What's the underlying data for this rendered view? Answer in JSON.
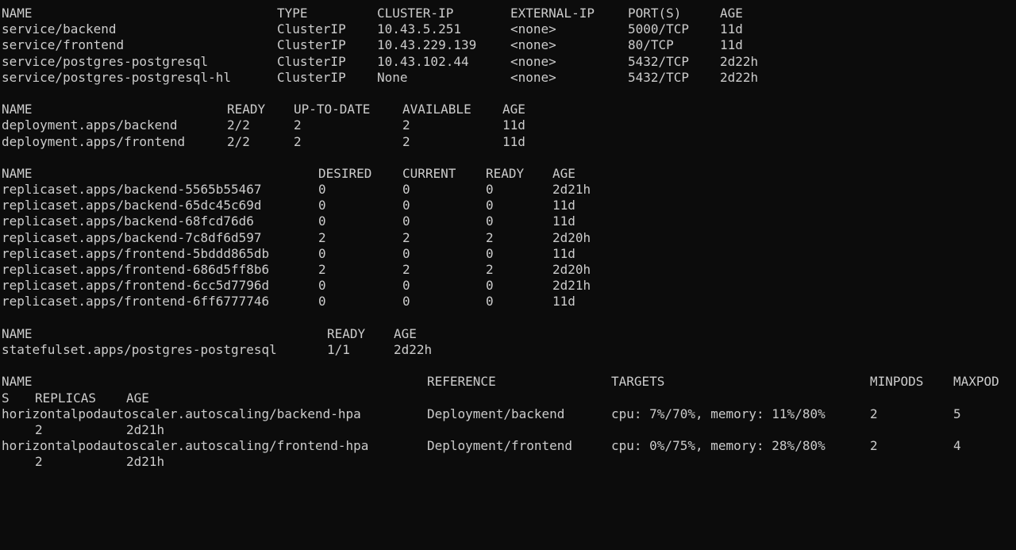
{
  "services": {
    "headers": [
      "NAME",
      "TYPE",
      "CLUSTER-IP",
      "EXTERNAL-IP",
      "PORT(S)",
      "AGE"
    ],
    "rows": [
      [
        "service/backend",
        "ClusterIP",
        "10.43.5.251",
        "<none>",
        "5000/TCP",
        "11d"
      ],
      [
        "service/frontend",
        "ClusterIP",
        "10.43.229.139",
        "<none>",
        "80/TCP",
        "11d"
      ],
      [
        "service/postgres-postgresql",
        "ClusterIP",
        "10.43.102.44",
        "<none>",
        "5432/TCP",
        "2d22h"
      ],
      [
        "service/postgres-postgresql-hl",
        "ClusterIP",
        "None",
        "<none>",
        "5432/TCP",
        "2d22h"
      ]
    ]
  },
  "deployments": {
    "headers": [
      "NAME",
      "READY",
      "UP-TO-DATE",
      "AVAILABLE",
      "AGE"
    ],
    "rows": [
      [
        "deployment.apps/backend",
        "2/2",
        "2",
        "2",
        "11d"
      ],
      [
        "deployment.apps/frontend",
        "2/2",
        "2",
        "2",
        "11d"
      ]
    ]
  },
  "replicasets": {
    "headers": [
      "NAME",
      "DESIRED",
      "CURRENT",
      "READY",
      "AGE"
    ],
    "rows": [
      [
        "replicaset.apps/backend-5565b55467",
        "0",
        "0",
        "0",
        "2d21h"
      ],
      [
        "replicaset.apps/backend-65dc45c69d",
        "0",
        "0",
        "0",
        "11d"
      ],
      [
        "replicaset.apps/backend-68fcd76d6",
        "0",
        "0",
        "0",
        "11d"
      ],
      [
        "replicaset.apps/backend-7c8df6d597",
        "2",
        "2",
        "2",
        "2d20h"
      ],
      [
        "replicaset.apps/frontend-5bddd865db",
        "0",
        "0",
        "0",
        "11d"
      ],
      [
        "replicaset.apps/frontend-686d5ff8b6",
        "2",
        "2",
        "2",
        "2d20h"
      ],
      [
        "replicaset.apps/frontend-6cc5d7796d",
        "0",
        "0",
        "0",
        "2d21h"
      ],
      [
        "replicaset.apps/frontend-6ff6777746",
        "0",
        "0",
        "0",
        "11d"
      ]
    ]
  },
  "statefulsets": {
    "headers": [
      "NAME",
      "READY",
      "AGE"
    ],
    "rows": [
      [
        "statefulset.apps/postgres-postgresql",
        "1/1",
        "2d22h"
      ]
    ]
  },
  "hpa": {
    "headers": [
      "NAME",
      "REFERENCE",
      "TARGETS",
      "MINPODS",
      "MAXPOD"
    ],
    "headers_wrap": [
      "S",
      "REPLICAS",
      "AGE"
    ],
    "rows": [
      {
        "main": [
          "horizontalpodautoscaler.autoscaling/backend-hpa",
          "Deployment/backend",
          "cpu: 7%/70%, memory: 11%/80%",
          "2",
          "5"
        ],
        "wrap": [
          "2",
          "2d21h"
        ]
      },
      {
        "main": [
          "horizontalpodautoscaler.autoscaling/frontend-hpa",
          "Deployment/frontend",
          "cpu: 0%/75%, memory: 28%/80%",
          "2",
          "4"
        ],
        "wrap": [
          "2",
          "2d21h"
        ]
      }
    ]
  },
  "colors": {
    "background": "#0c0c0c",
    "foreground": "#cccccc"
  }
}
